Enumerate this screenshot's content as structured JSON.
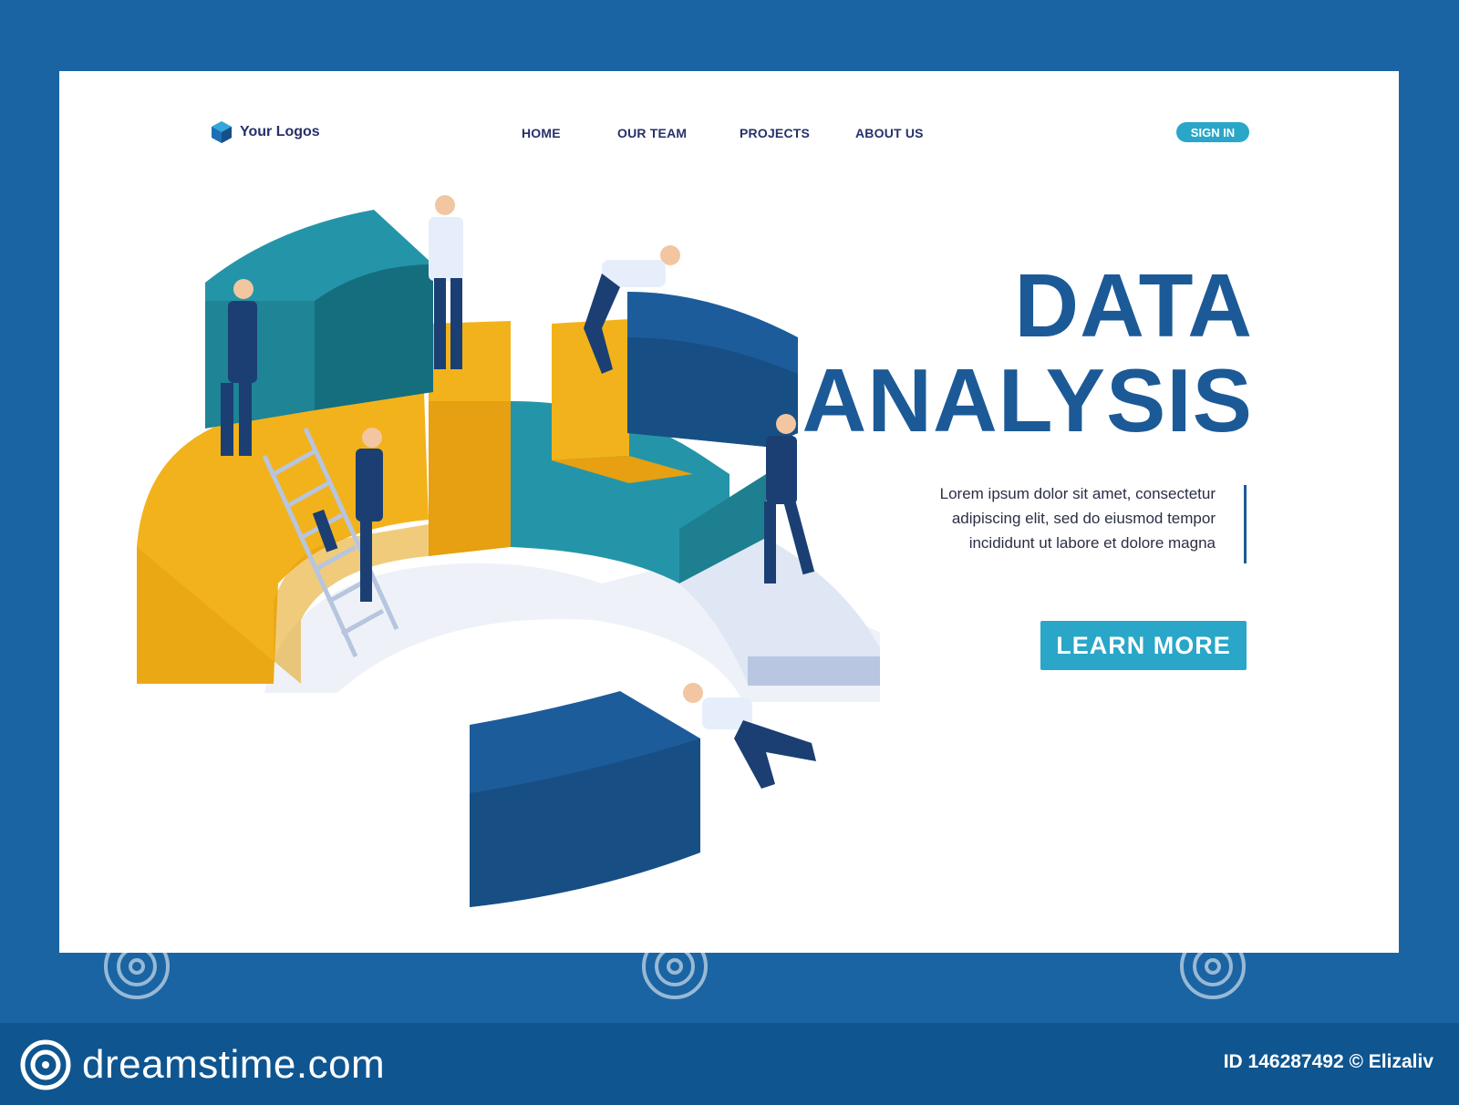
{
  "brand": {
    "logo_text": "Your Logos",
    "logo_icon": "hexagon-cube-icon"
  },
  "nav": {
    "items": [
      {
        "label": "HOME"
      },
      {
        "label": "OUR TEAM"
      },
      {
        "label": "PROJECTS"
      },
      {
        "label": "ABOUT US"
      }
    ],
    "sign_in": "SIGN IN"
  },
  "hero": {
    "title_line1": "DATA",
    "title_line2": "ANALYSIS",
    "description_line1": "Lorem ipsum dolor sit amet, consectetur",
    "description_line2": "adipiscing elit, sed do eiusmod tempor",
    "description_line3": "incididunt ut labore et dolore magna",
    "cta": "LEARN MORE"
  },
  "illustration": {
    "name": "isometric-pie-chart-teamwork",
    "icon": "pie-chart-icon"
  },
  "footer": {
    "brand": "dreamstime.com",
    "image_id": "ID 146287492 © Elizaliv"
  },
  "colors": {
    "frame": "#1a64a3",
    "title": "#1c5a97",
    "accent": "#2aa6c8",
    "yellow": "#f2b21b",
    "teal": "#2495a8",
    "navy": "#1d5c9b"
  }
}
